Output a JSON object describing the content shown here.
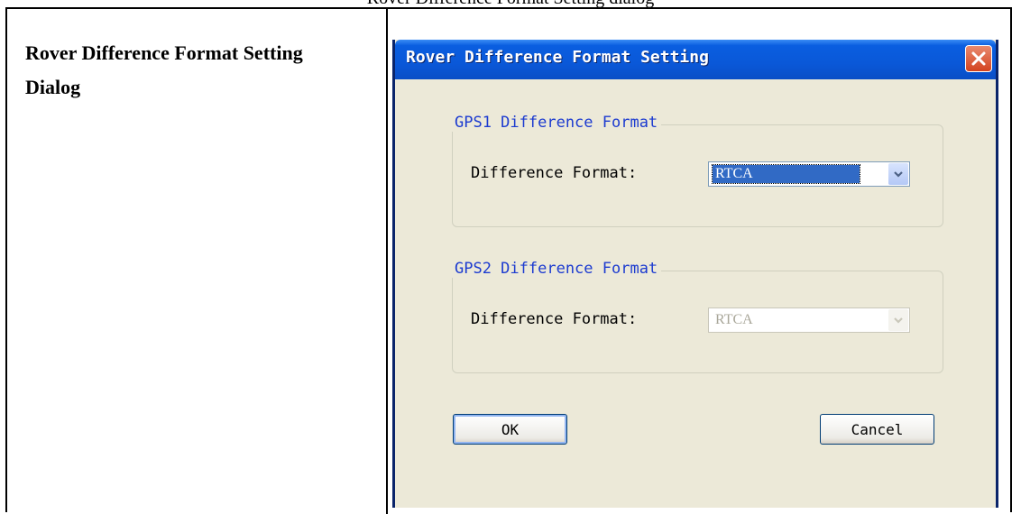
{
  "page": {
    "caption": "Rover Difference Format Setting dialog",
    "row_label": "Rover Difference Format Setting Dialog"
  },
  "dialog": {
    "title": "Rover Difference Format Setting",
    "groups": [
      {
        "legend": "GPS1 Difference Format",
        "field_label": "Difference Format:",
        "selected_value": "RTCA",
        "enabled": true
      },
      {
        "legend": "GPS2 Difference Format",
        "field_label": "Difference Format:",
        "selected_value": "RTCA",
        "enabled": false
      }
    ],
    "buttons": {
      "ok": "OK",
      "cancel": "Cancel"
    }
  },
  "colors": {
    "titlebar": "#0a58d8",
    "dialog_bg": "#ece9d8",
    "group_legend": "#1c3bd0",
    "selection": "#316ac5",
    "close_button": "#d3431f"
  }
}
